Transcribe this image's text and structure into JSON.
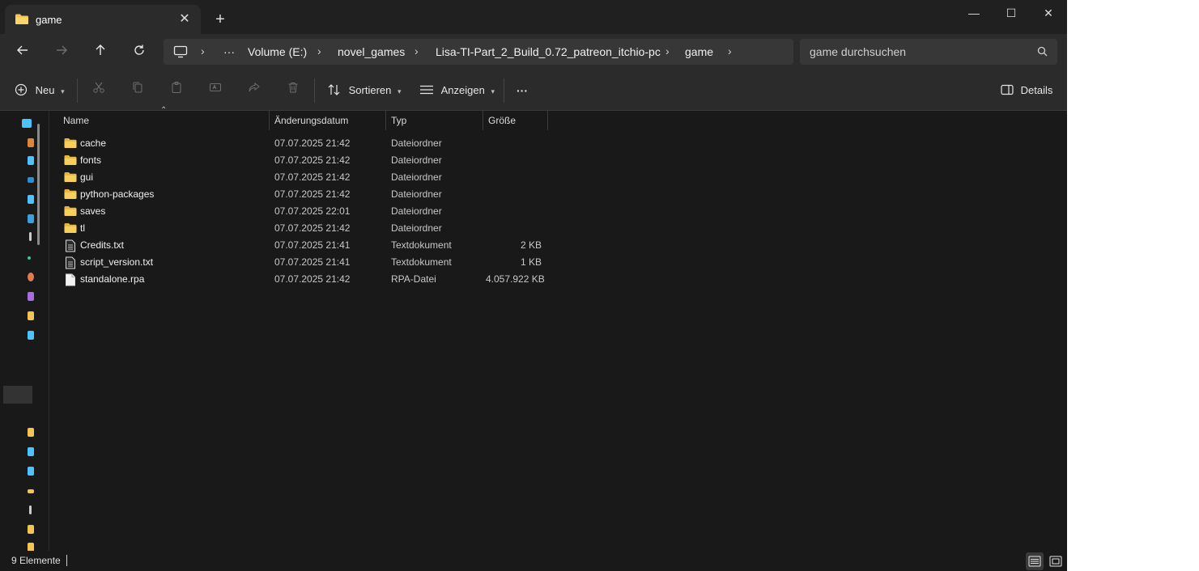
{
  "tab": {
    "title": "game",
    "close_glyph": "✕",
    "new_glyph": "+"
  },
  "window_controls": {
    "minimize": "—",
    "maximize": "☐",
    "close": "✕"
  },
  "breadcrumb": {
    "overflow": "···",
    "items": [
      "Volume (E:)",
      "novel_games",
      "Lisa-TI-Part_2_Build_0.72_patreon_itchio-pc",
      "game"
    ]
  },
  "search": {
    "placeholder": "game durchsuchen"
  },
  "toolbar": {
    "new_label": "Neu",
    "sort_label": "Sortieren",
    "view_label": "Anzeigen",
    "more_label": "···",
    "details_label": "Details"
  },
  "columns": {
    "name": "Name",
    "date": "Änderungsdatum",
    "type": "Typ",
    "size": "Größe"
  },
  "files": [
    {
      "name": "cache",
      "date": "07.07.2025 21:42",
      "type": "Dateiordner",
      "size": "",
      "icon": "folder-icon"
    },
    {
      "name": "fonts",
      "date": "07.07.2025 21:42",
      "type": "Dateiordner",
      "size": "",
      "icon": "folder-icon"
    },
    {
      "name": "gui",
      "date": "07.07.2025 21:42",
      "type": "Dateiordner",
      "size": "",
      "icon": "folder-icon"
    },
    {
      "name": "python-packages",
      "date": "07.07.2025 21:42",
      "type": "Dateiordner",
      "size": "",
      "icon": "folder-icon"
    },
    {
      "name": "saves",
      "date": "07.07.2025 22:01",
      "type": "Dateiordner",
      "size": "",
      "icon": "folder-icon"
    },
    {
      "name": "tl",
      "date": "07.07.2025 21:42",
      "type": "Dateiordner",
      "size": "",
      "icon": "folder-icon"
    },
    {
      "name": "Credits.txt",
      "date": "07.07.2025 21:41",
      "type": "Textdokument",
      "size": "2 KB",
      "icon": "text-file-icon"
    },
    {
      "name": "script_version.txt",
      "date": "07.07.2025 21:41",
      "type": "Textdokument",
      "size": "1 KB",
      "icon": "text-file-icon"
    },
    {
      "name": "standalone.rpa",
      "date": "07.07.2025 21:42",
      "type": "RPA-Datei",
      "size": "4.057.922 KB",
      "icon": "file-icon"
    }
  ],
  "status": {
    "count": "9 Elemente"
  },
  "colors": {
    "folder": "#f4c552",
    "accent": "#4cc2ff",
    "background": "#191919",
    "chrome": "#2b2b2b"
  }
}
